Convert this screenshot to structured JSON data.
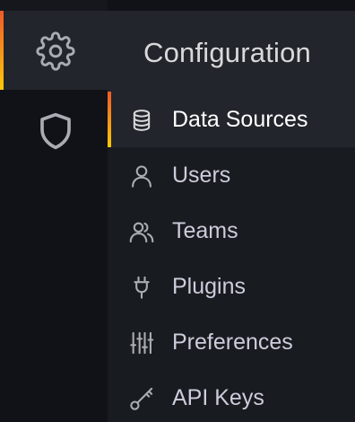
{
  "menu": {
    "title": "Configuration",
    "active_index": 0,
    "items": [
      {
        "label": "Data Sources",
        "icon": "database-icon"
      },
      {
        "label": "Users",
        "icon": "user-icon"
      },
      {
        "label": "Teams",
        "icon": "users-icon"
      },
      {
        "label": "Plugins",
        "icon": "plug-icon"
      },
      {
        "label": "Preferences",
        "icon": "sliders-icon"
      },
      {
        "label": "API Keys",
        "icon": "key-icon"
      }
    ]
  },
  "rail": {
    "items": [
      {
        "icon": "gear-icon",
        "active": true
      },
      {
        "icon": "shield-icon",
        "active": false
      }
    ]
  },
  "colors": {
    "background": "#111217",
    "menu_background": "#181b1f",
    "active_background": "#22252b",
    "accent_start": "#f05a28",
    "accent_end": "#fbca0a",
    "text": "#ccccdc",
    "icon": "#a9acb3"
  }
}
